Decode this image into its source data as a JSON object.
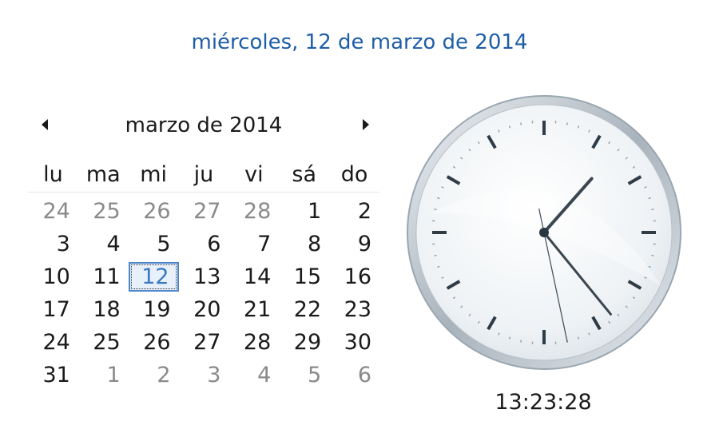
{
  "header": {
    "full_date": "miércoles, 12 de marzo de 2014"
  },
  "calendar": {
    "month_title": "marzo de 2014",
    "prev_icon": "triangle-left-icon",
    "next_icon": "triangle-right-icon",
    "weekdays": [
      "lu",
      "ma",
      "mi",
      "ju",
      "vi",
      "sá",
      "do"
    ],
    "days": [
      {
        "d": "24",
        "other": true
      },
      {
        "d": "25",
        "other": true
      },
      {
        "d": "26",
        "other": true
      },
      {
        "d": "27",
        "other": true
      },
      {
        "d": "28",
        "other": true
      },
      {
        "d": "1"
      },
      {
        "d": "2"
      },
      {
        "d": "3"
      },
      {
        "d": "4"
      },
      {
        "d": "5"
      },
      {
        "d": "6"
      },
      {
        "d": "7"
      },
      {
        "d": "8"
      },
      {
        "d": "9"
      },
      {
        "d": "10"
      },
      {
        "d": "11"
      },
      {
        "d": "12",
        "today": true
      },
      {
        "d": "13"
      },
      {
        "d": "14"
      },
      {
        "d": "15"
      },
      {
        "d": "16"
      },
      {
        "d": "17"
      },
      {
        "d": "18"
      },
      {
        "d": "19"
      },
      {
        "d": "20"
      },
      {
        "d": "21"
      },
      {
        "d": "22"
      },
      {
        "d": "23"
      },
      {
        "d": "24"
      },
      {
        "d": "25"
      },
      {
        "d": "26"
      },
      {
        "d": "27"
      },
      {
        "d": "28"
      },
      {
        "d": "29"
      },
      {
        "d": "30"
      },
      {
        "d": "31"
      },
      {
        "d": "1",
        "other": true
      },
      {
        "d": "2",
        "other": true
      },
      {
        "d": "3",
        "other": true
      },
      {
        "d": "4",
        "other": true
      },
      {
        "d": "5",
        "other": true
      },
      {
        "d": "6",
        "other": true
      }
    ]
  },
  "clock": {
    "time": "13:23:28",
    "hour": 13,
    "minute": 23,
    "second": 28
  },
  "colors": {
    "accent": "#1e5ea8",
    "today_border": "#4b86c8",
    "other_month": "#8a8a8a"
  }
}
